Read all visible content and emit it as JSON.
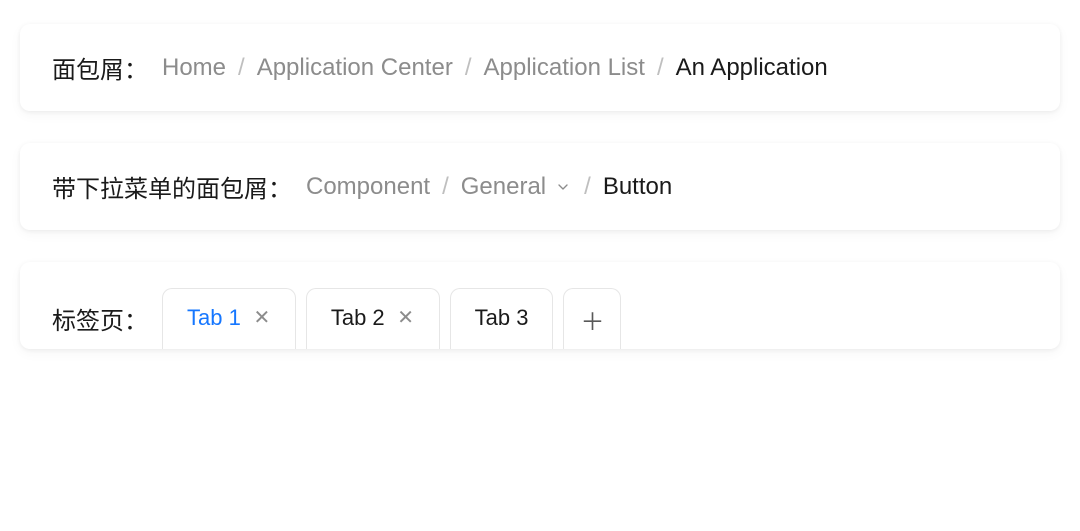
{
  "section1": {
    "label": "面包屑：",
    "items": [
      {
        "text": "Home",
        "current": false
      },
      {
        "text": "Application Center",
        "current": false
      },
      {
        "text": "Application List",
        "current": false
      },
      {
        "text": "An Application",
        "current": true
      }
    ],
    "separator": "/"
  },
  "section2": {
    "label": "带下拉菜单的面包屑：",
    "items": [
      {
        "text": "Component",
        "current": false,
        "dropdown": false
      },
      {
        "text": "General",
        "current": false,
        "dropdown": true
      },
      {
        "text": "Button",
        "current": true,
        "dropdown": false
      }
    ],
    "separator": "/"
  },
  "section3": {
    "label": "标签页：",
    "tabs": [
      {
        "label": "Tab 1",
        "active": true,
        "closable": true
      },
      {
        "label": "Tab 2",
        "active": false,
        "closable": true
      },
      {
        "label": "Tab 3",
        "active": false,
        "closable": false
      }
    ],
    "close_glyph": "✕",
    "add_glyph": "＋"
  }
}
